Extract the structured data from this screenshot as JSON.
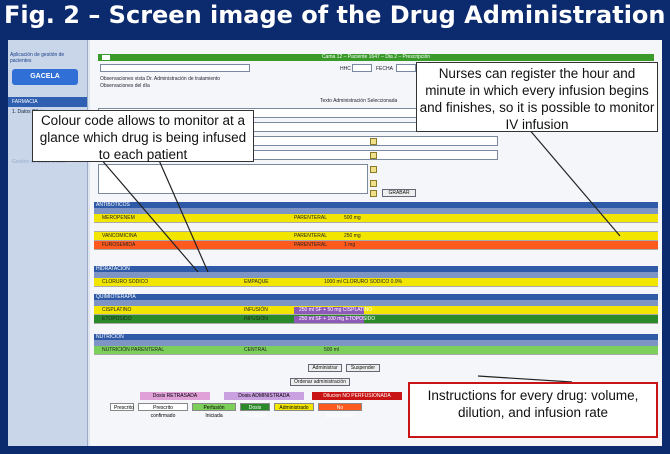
{
  "banner": {
    "title": "Fig. 2 – Screen image of the Drug Administration Register Progr"
  },
  "sidebar": {
    "title": "Aplicación de gestión de pacientes",
    "logo": "GACELA",
    "items": [
      {
        "label": "FARMACIA"
      },
      {
        "label": "1. Datos Clínicos"
      },
      {
        "label": "Gestión de tratamientos"
      }
    ]
  },
  "main": {
    "topbar_title": "Cama 12 – Paciente 1647 – Dia 2 – Prescripción",
    "header_fields": {
      "label_1": "HHC",
      "label_2": "FECHA"
    },
    "obs_1": "Observaciones vista Dr. Administración de tratamiento",
    "obs_2": "Observaciones del día",
    "sub_title": "Texto Administración Seleccionada",
    "grabar_label": "GRABAR",
    "sections": [
      {
        "title": "ANTIBÓTICOS",
        "rows": [
          {
            "name": "MEROPENEM",
            "route": "PARENTERAL",
            "dose": "500 mg",
            "color": "#f2e600",
            "text_color": "#333"
          },
          {
            "name": "",
            "route": "",
            "dose": "",
            "color": "#f4f4f4",
            "text_color": "#333"
          },
          {
            "name": "VANCOMICINA",
            "route": "PARENTERAL",
            "dose": "250 mg",
            "color": "#f2e600",
            "text_color": "#333"
          },
          {
            "name": "FUROSEMIDA",
            "route": "PARENTERAL",
            "dose": "1 mg",
            "color": "#ff5a1e",
            "text_color": "#fff"
          }
        ]
      },
      {
        "title": "HIDRATACIÓN",
        "rows": [
          {
            "name": "CLORURO SODICO",
            "route": "EMPAQUE",
            "dose": "1000 ml CLORURO SODICO 0.9%",
            "color": "#f2e600",
            "text_color": "#333"
          }
        ]
      },
      {
        "title": "QUIMIOTERAPIA",
        "rows": [
          {
            "name": "CISPLATINO",
            "route": "INFUSIÓN",
            "dose": "250 ml SF + 50 mg CISPLATINO",
            "color": "#f2e600",
            "text_color": "#333"
          },
          {
            "name": "ETOPOSIDO",
            "route": "INFUSIÓN",
            "dose": "250 ml SF + 100 mg ETOPOSIDO",
            "color": "#2a8a2a",
            "text_color": "#fff"
          }
        ]
      },
      {
        "title": "NUTRICIÓN",
        "rows": [
          {
            "name": "NUTRICIÓN PARENTERAL",
            "route": "CENTRAL",
            "dose": "500 ml",
            "color": "#7ccf5a",
            "text_color": "#333"
          }
        ]
      }
    ],
    "action_buttons": [
      {
        "label": "Administrar"
      },
      {
        "label": "Suspender"
      }
    ],
    "order_button": "Ordenar administración",
    "legend_row_1": [
      {
        "label": "Dosis RETRASADA",
        "color": "#e0a0d8"
      },
      {
        "label": "Dosis ADMINISTRADA",
        "color": "#c9a0e0"
      },
      {
        "label": "Dilucion NO PERFUSIONADA",
        "color": "#c81414"
      }
    ],
    "legend_row_2": [
      {
        "label": "Prescrito",
        "color": "#ffffff"
      },
      {
        "label": "Prescrito confirmado",
        "color": "#ffffff"
      },
      {
        "label": "Perfusión Iniciada",
        "color": "#7ccf5a"
      },
      {
        "label": "Dosis Pendiente",
        "color": "#2a8a2a"
      },
      {
        "label": "Administrado",
        "color": "#f2e600"
      },
      {
        "label": "No administrado",
        "color": "#ff5a1e"
      }
    ]
  },
  "callouts": {
    "colour_code": "Colour code allows to monitor at a glance which drug is being infused to each patient",
    "nurses": "Nurses can register the hour and minute in which every infusion begins and finishes, so it is possible to monitor IV infusion",
    "instructions": "Instructions for every drug: volume, dilution, and infusion rate"
  }
}
